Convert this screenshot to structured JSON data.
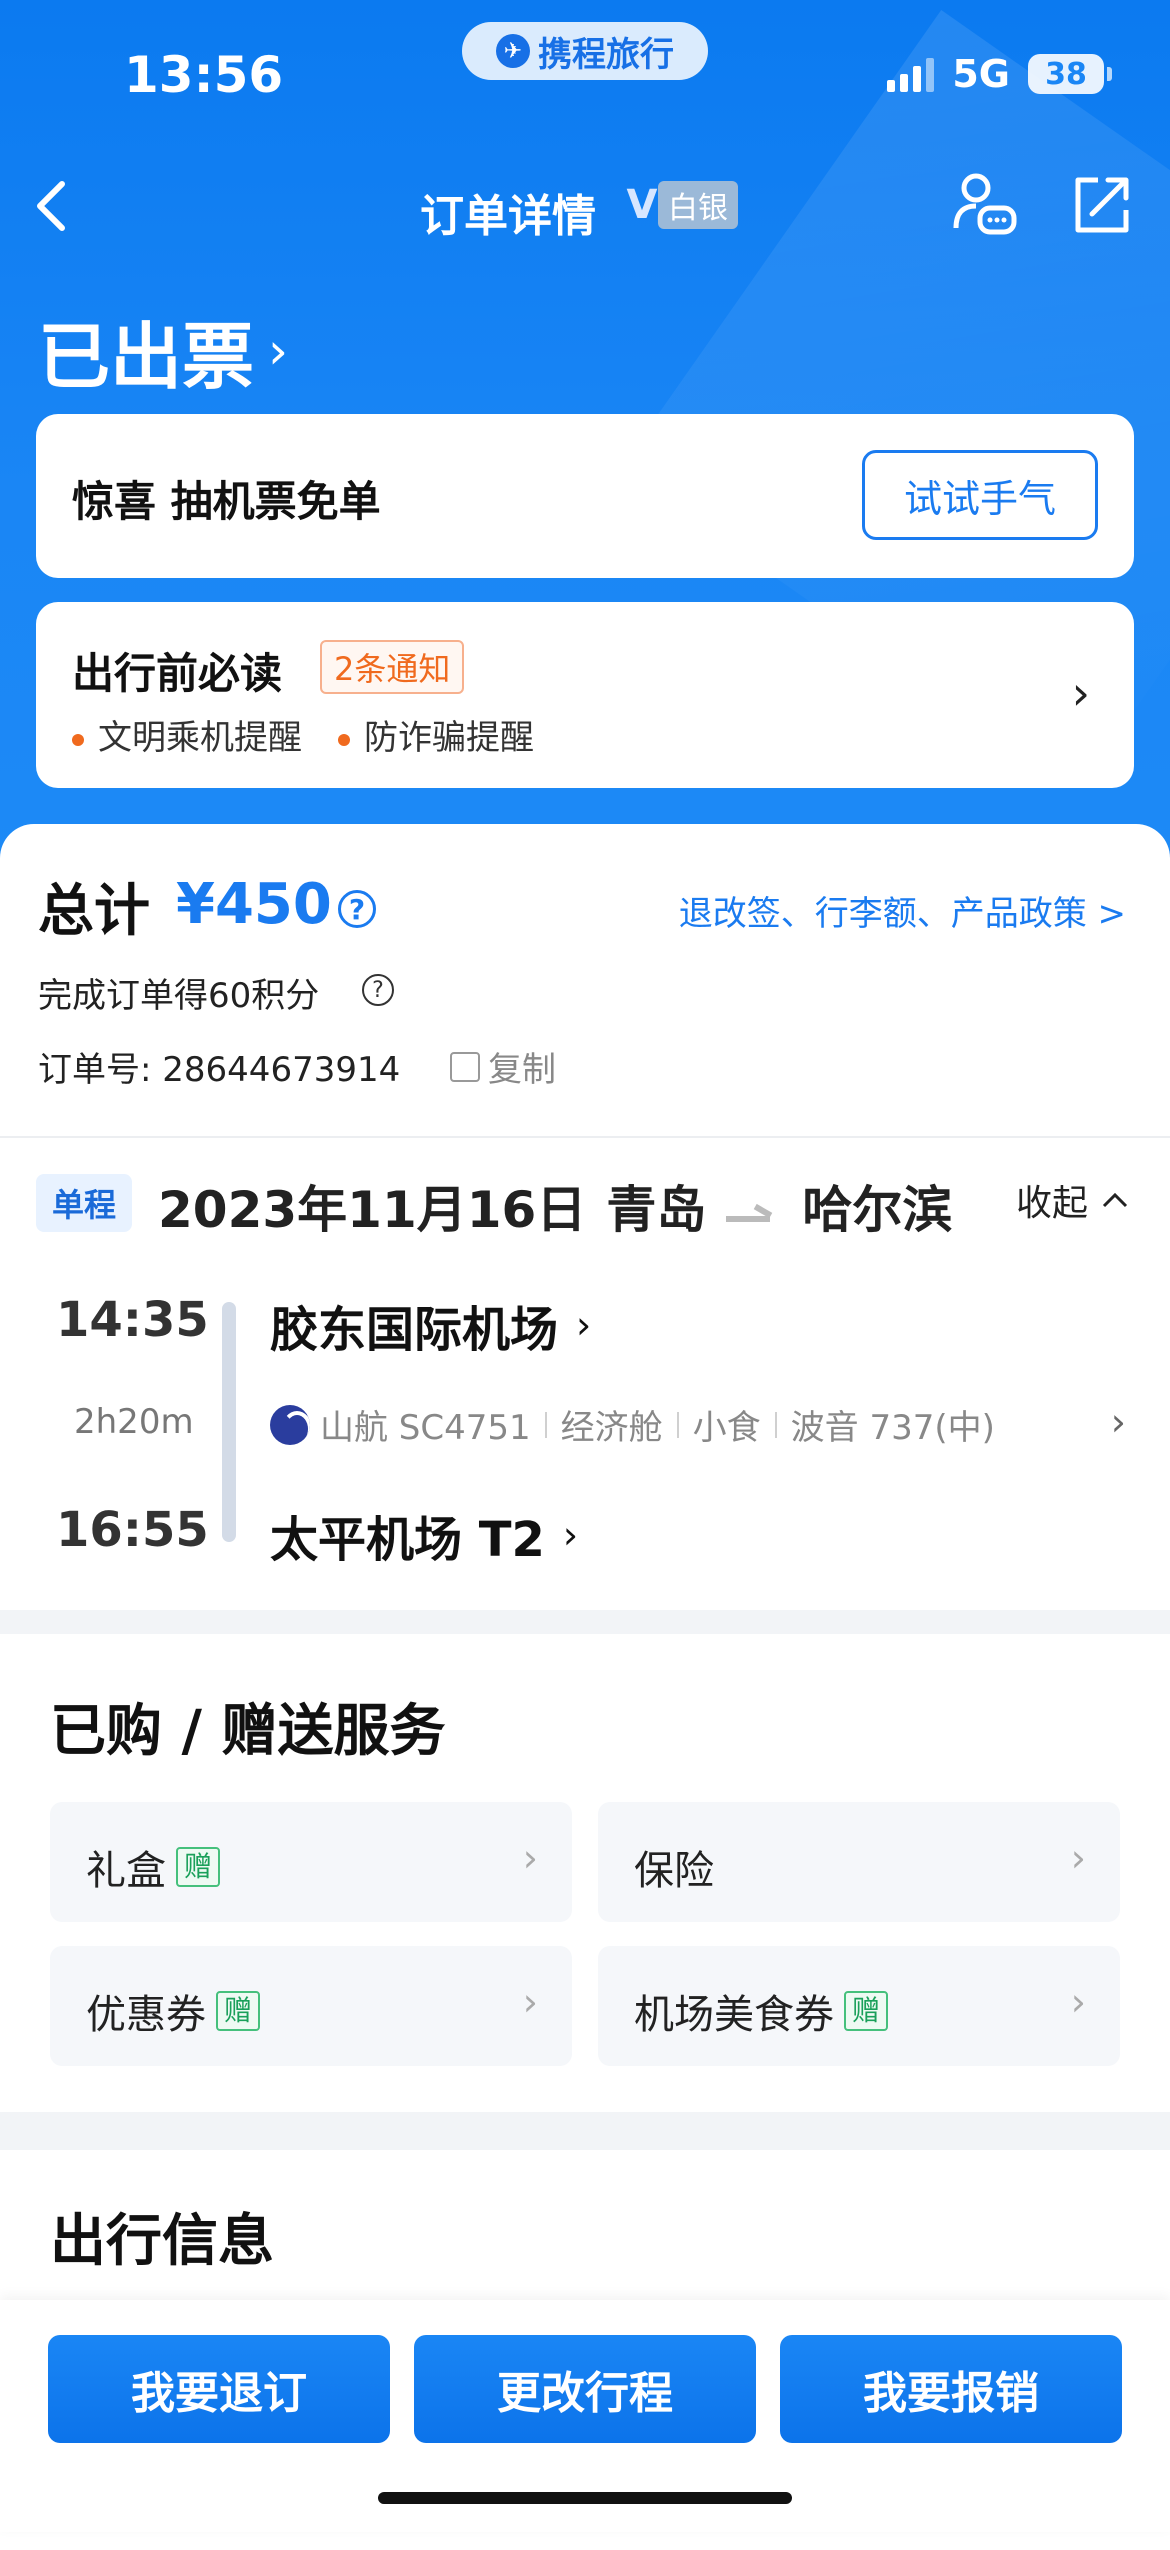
{
  "status_bar": {
    "time": "13:56",
    "brand": "携程旅行",
    "network": "5G",
    "battery": "38"
  },
  "nav": {
    "title": "订单详情",
    "member_level": "白银"
  },
  "ticket_status": "已出票",
  "promo": {
    "text": "惊喜 抽机票免单",
    "button": "试试手气"
  },
  "notice": {
    "title": "出行前必读",
    "badge": "2条通知",
    "items": [
      "文明乘机提醒",
      "防诈骗提醒"
    ]
  },
  "order": {
    "total_label": "总计",
    "total_price": "¥450",
    "policy_link": "退改签、行李额、产品政策 >",
    "points_text": "完成订单得60积分",
    "order_no_label": "订单号:",
    "order_no": "28644673914",
    "copy_label": "复制"
  },
  "trip": {
    "tag": "单程",
    "date": "2023年11月16日",
    "from": "青岛",
    "to": "哈尔滨",
    "collapse_label": "收起",
    "dep_time": "14:35",
    "duration": "2h20m",
    "arr_time": "16:55",
    "dep_airport": "胶东国际机场",
    "arr_airport": "太平机场 T2",
    "airline_flight": "山航 SC4751",
    "cabin": "经济舱",
    "meal": "小食",
    "aircraft": "波音 737(中)"
  },
  "services": {
    "title": "已购 / 赠送服务",
    "gift_tag": "赠",
    "items": [
      {
        "label": "礼盒",
        "gift": true
      },
      {
        "label": "保险",
        "gift": false
      },
      {
        "label": "优惠券",
        "gift": true
      },
      {
        "label": "机场美食券",
        "gift": true
      }
    ]
  },
  "travel_info": {
    "title": "出行信息"
  },
  "actions": {
    "refund": "我要退订",
    "change": "更改行程",
    "reimburse": "我要报销"
  }
}
